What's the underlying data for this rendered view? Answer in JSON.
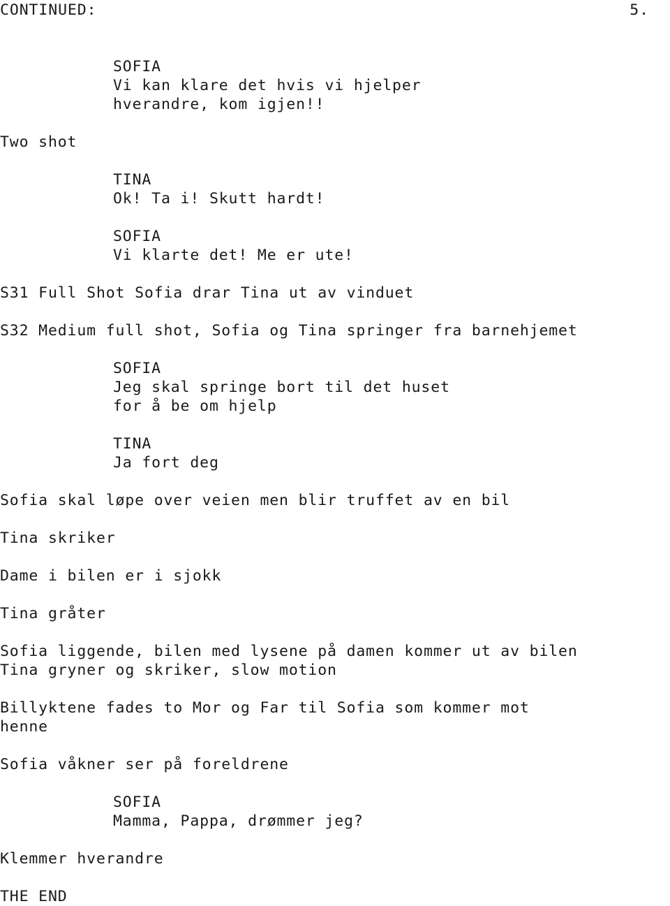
{
  "document": {
    "type": "screenplay-page",
    "language": "no",
    "header": {
      "continued_label": "CONTINUED:",
      "page_number": "5."
    },
    "footer_note": "THE END"
  },
  "blocks": [
    {
      "id": "b1",
      "kind": "dialogue",
      "character": "SOFIA",
      "lines": [
        "Vi kan klare det hvis vi hjelper",
        "hverandre, kom igjen!!"
      ]
    },
    {
      "id": "b2",
      "kind": "action",
      "lines": [
        "Two shot"
      ]
    },
    {
      "id": "b3",
      "kind": "dialogue",
      "character": "TINA",
      "lines": [
        "Ok! Ta i! Skutt hardt!"
      ]
    },
    {
      "id": "b4",
      "kind": "dialogue",
      "character": "SOFIA",
      "lines": [
        "Vi klarte det! Me er ute!"
      ]
    },
    {
      "id": "b5",
      "kind": "action",
      "lines": [
        "S31 Full Shot Sofia drar Tina ut av vinduet"
      ]
    },
    {
      "id": "b6",
      "kind": "action",
      "lines": [
        "S32 Medium full shot, Sofia og Tina springer fra barnehjemet"
      ]
    },
    {
      "id": "b7",
      "kind": "dialogue",
      "character": "SOFIA",
      "lines": [
        "Jeg skal springe bort til det huset",
        "for å be om hjelp"
      ]
    },
    {
      "id": "b8",
      "kind": "dialogue",
      "character": "TINA",
      "lines": [
        "Ja fort deg"
      ]
    },
    {
      "id": "b9",
      "kind": "action",
      "lines": [
        "Sofia skal løpe over veien men blir truffet av en bil"
      ]
    },
    {
      "id": "b10",
      "kind": "action",
      "lines": [
        "Tina skriker"
      ]
    },
    {
      "id": "b11",
      "kind": "action",
      "lines": [
        "Dame i bilen er i sjokk"
      ]
    },
    {
      "id": "b12",
      "kind": "action",
      "lines": [
        "Tina gråter"
      ]
    },
    {
      "id": "b13",
      "kind": "action",
      "lines": [
        "Sofia liggende, bilen med lysene på damen kommer ut av bilen",
        "Tina gryner og skriker, slow motion"
      ]
    },
    {
      "id": "b14",
      "kind": "action",
      "lines": [
        "Billyktene fades to Mor og Far til Sofia som kommer mot",
        "henne"
      ]
    },
    {
      "id": "b15",
      "kind": "action",
      "lines": [
        "Sofia våkner ser på foreldrene"
      ]
    },
    {
      "id": "b16",
      "kind": "dialogue",
      "character": "SOFIA",
      "lines": [
        "Mamma, Pappa, drømmer jeg?"
      ]
    },
    {
      "id": "b17",
      "kind": "action",
      "lines": [
        "Klemmer hverandre"
      ]
    },
    {
      "id": "b18",
      "kind": "action",
      "lines": [
        "THE END"
      ]
    }
  ]
}
